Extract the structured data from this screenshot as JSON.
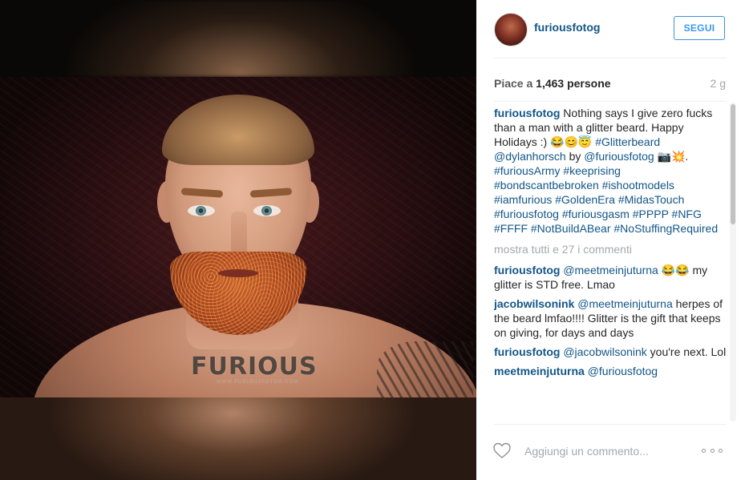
{
  "post": {
    "username": "furiousfotog",
    "follow_label": "SEGUI",
    "likes_prefix": "Piace a ",
    "likes_count": "1,463",
    "likes_suffix": " persone",
    "time_ago": "2 g",
    "caption": {
      "username": "furiousfotog",
      "text_1": " Nothing says I give zero fucks than a man with a glitter beard. Happy Holidays :) 😂😊😇 ",
      "hashtag_1": "#Glitterbeard",
      "mention_1": "@dylanhorsch",
      "text_by": " by ",
      "mention_2": "@furiousfotog",
      "text_2": " 📷💥. ",
      "hashtags": "#furiousArmy #keeprising #bondscantbebroken #ishootmodels #iamfurious #GoldenEra #MidasTouch #furiousfotog #furiousgasm #PPPP #NFG #FFFF #NotBuildABear #NoStuffingRequired"
    },
    "show_all_comments": "mostra tutti e 27 i commenti",
    "comments": [
      {
        "user": "furiousfotog",
        "mention": "@meetmeinjuturna",
        "text": " 😂😂 my glitter is STD free. Lmao"
      },
      {
        "user": "jacobwilsonink",
        "mention": "@meetmeinjuturna",
        "text": " herpes of the beard lmfao!!!! Glitter is the gift that keeps on giving, for days and days"
      },
      {
        "user": "furiousfotog",
        "mention": "@jacobwilsonink",
        "text": " you're next. Lol"
      },
      {
        "user": "meetmeinjuturna",
        "mention": "@furiousfotog",
        "text": ""
      }
    ],
    "add_comment_placeholder": "Aggiungi un commento..."
  },
  "media": {
    "watermark": "FURIOUS",
    "watermark_sub": "WWW.FURIOUSFOTOG.COM"
  },
  "icons": {
    "like": "heart-outline-icon",
    "more": "more-options-icon"
  },
  "colors": {
    "link": "#125688",
    "follow_border": "#4090db",
    "muted": "#a5a7aa"
  }
}
